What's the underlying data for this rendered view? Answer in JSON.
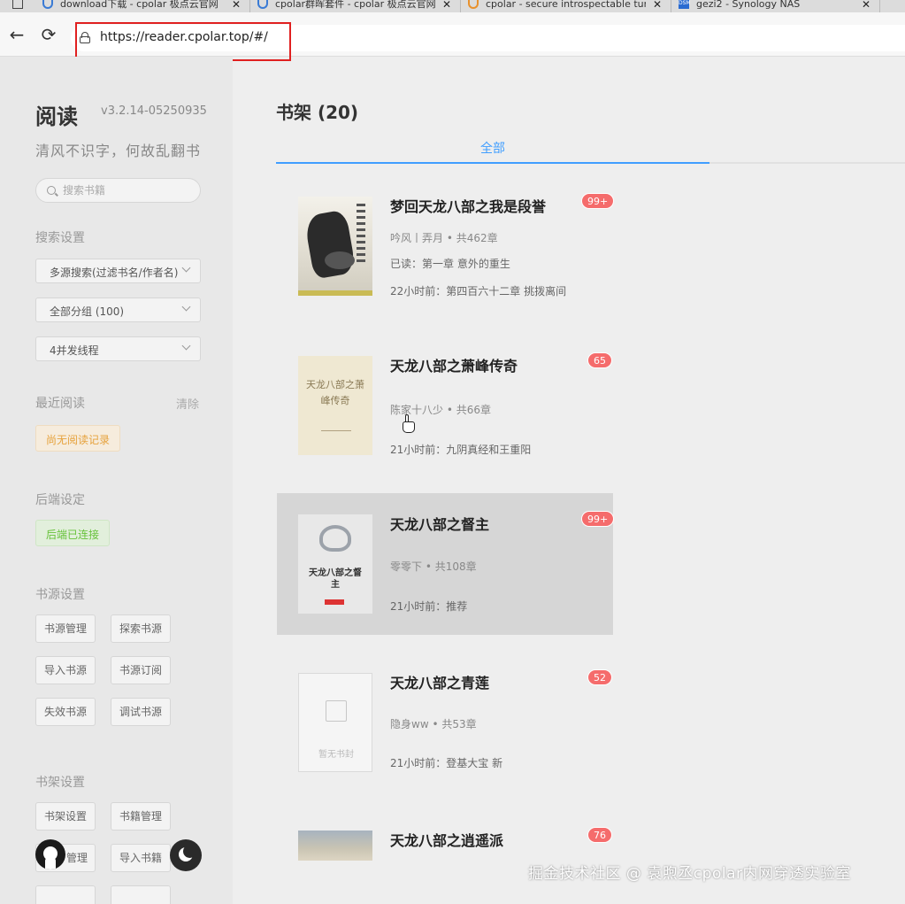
{
  "browser": {
    "tabs": [
      {
        "title": "download下载 - cpolar 极点云官网",
        "icon": "cpolar-blue-icon"
      },
      {
        "title": "cpolar群晖套件 - cpolar 极点云官网",
        "icon": "cpolar-blue-icon"
      },
      {
        "title": "cpolar - secure introspectable tunnels",
        "icon": "cpolar-orange-icon"
      },
      {
        "title": "gezi2 - Synology NAS",
        "icon": "dsm-icon"
      }
    ],
    "url": "https://reader.cpolar.top/#/"
  },
  "sidebar": {
    "app_name": "阅读",
    "version": "v3.2.14-05250935",
    "slogan": "清风不识字，何故乱翻书",
    "search_placeholder": "搜索书籍",
    "search_settings_label": "搜索设置",
    "search_source_select": "多源搜索(过滤书名/作者名)",
    "group_select": "全部分组 (100)",
    "threads_select": "4并发线程",
    "recent_label": "最近阅读",
    "clear_label": "清除",
    "no_history": "尚无阅读记录",
    "backend_label": "后端设定",
    "backend_status": "后端已连接",
    "source_label": "书源设置",
    "source_buttons": [
      "书源管理",
      "探索书源",
      "导入书源",
      "书源订阅",
      "失效书源",
      "调试书源"
    ],
    "shelf_label": "书架设置",
    "shelf_buttons": [
      "书架设置",
      "书籍管理",
      "管理",
      "导入书籍"
    ]
  },
  "main": {
    "title": "书架 (20)",
    "tab_all": "全部",
    "books": [
      {
        "title": "梦回天龙八部之我是段誉",
        "badge": "99+",
        "meta": "吟风丨弄月 • 共462章",
        "read": "已读：第一章 意外的重生",
        "latest": "22小时前：第四百六十二章 挑拨离间"
      },
      {
        "title": "天龙八部之萧峰传奇",
        "badge": "65",
        "meta": "陈家十八少 • 共66章",
        "read": "",
        "latest": "21小时前：九阴真经和王重阳",
        "cover_text": "天龙八部之萧峰传奇"
      },
      {
        "title": "天龙八部之督主",
        "badge": "99+",
        "meta": "零零下 • 共108章",
        "read": "",
        "latest": "21小时前：推荐",
        "cover_text": "天龙八部之督主"
      },
      {
        "title": "天龙八部之青莲",
        "badge": "52",
        "meta": "隐身ww • 共53章",
        "read": "",
        "latest": "21小时前：登基大宝 新",
        "cover_text": "暂无书封"
      },
      {
        "title": "天龙八部之逍遥派",
        "badge": "76",
        "meta": "",
        "read": "",
        "latest": ""
      }
    ]
  },
  "watermark": "掘金技术社区 @ 袁煦丞cpolar内网穿透实验室"
}
